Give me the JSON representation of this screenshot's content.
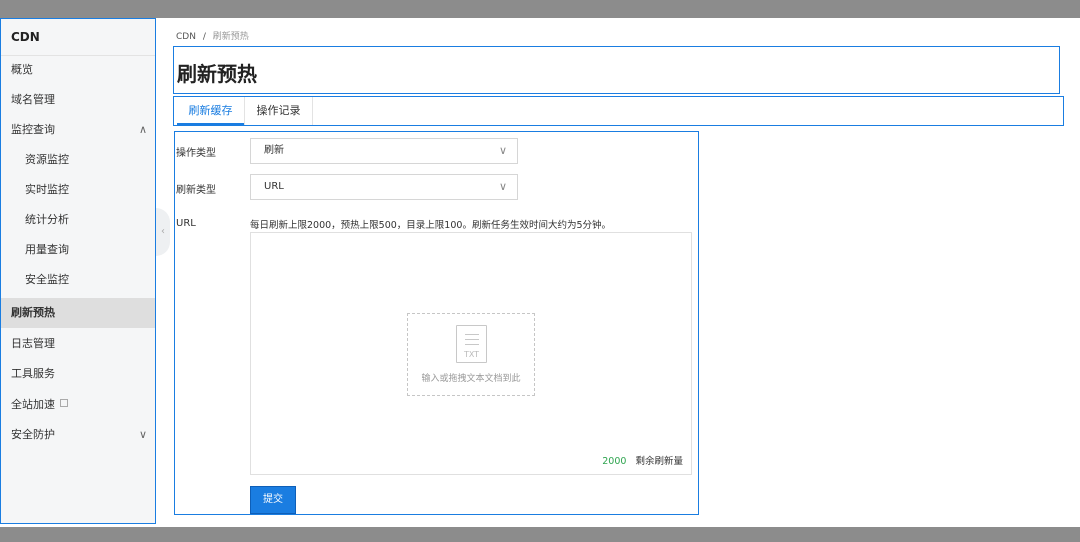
{
  "sidebar": {
    "title": "CDN",
    "items": [
      {
        "label": "概览",
        "name": "sidebar-item-overview"
      },
      {
        "label": "域名管理",
        "name": "sidebar-item-domain-management"
      },
      {
        "label": "监控查询",
        "name": "sidebar-item-monitoring-query"
      },
      {
        "label": "资源监控",
        "name": "sidebar-item-resource-monitoring"
      },
      {
        "label": "实时监控",
        "name": "sidebar-item-realtime-monitoring"
      },
      {
        "label": "统计分析",
        "name": "sidebar-item-statistics"
      },
      {
        "label": "用量查询",
        "name": "sidebar-item-usage-query"
      },
      {
        "label": "安全监控",
        "name": "sidebar-item-security-monitoring"
      },
      {
        "label": "刷新预热",
        "name": "sidebar-item-refresh-preload"
      },
      {
        "label": "日志管理",
        "name": "sidebar-item-log-management"
      },
      {
        "label": "工具服务",
        "name": "sidebar-item-tool-services"
      },
      {
        "label": "全站加速",
        "name": "sidebar-item-dcdn"
      },
      {
        "label": "安全防护",
        "name": "sidebar-item-security-protection"
      }
    ]
  },
  "breadcrumb": {
    "root": "CDN",
    "separator": "/",
    "current": "刷新预热"
  },
  "page": {
    "title": "刷新预热"
  },
  "tabs": [
    {
      "label": "刷新缓存",
      "active": true
    },
    {
      "label": "操作记录",
      "active": false
    }
  ],
  "form": {
    "operation_type_label": "操作类型",
    "operation_type_value": "刷新",
    "refresh_type_label": "刷新类型",
    "refresh_type_value": "URL",
    "url_label": "URL",
    "url_hint": "每日刷新上限2000，预热上限500，目录上限100。刷新任务生效时间大约为5分钟。",
    "file_icon_text": "TXT",
    "dropzone_text": "输入或拖拽文本文档到此",
    "remaining_count": "2000",
    "remaining_label": "剩余刷新量",
    "submit_label": "提交"
  },
  "icons": {
    "chevron_up": "∧",
    "chevron_down": "∨",
    "collapse": "‹"
  },
  "colors": {
    "accent": "#1a7de1",
    "count_green": "#2ea44f",
    "sidebar_bg": "#f5f6f7",
    "active_item_bg": "#dedede"
  }
}
